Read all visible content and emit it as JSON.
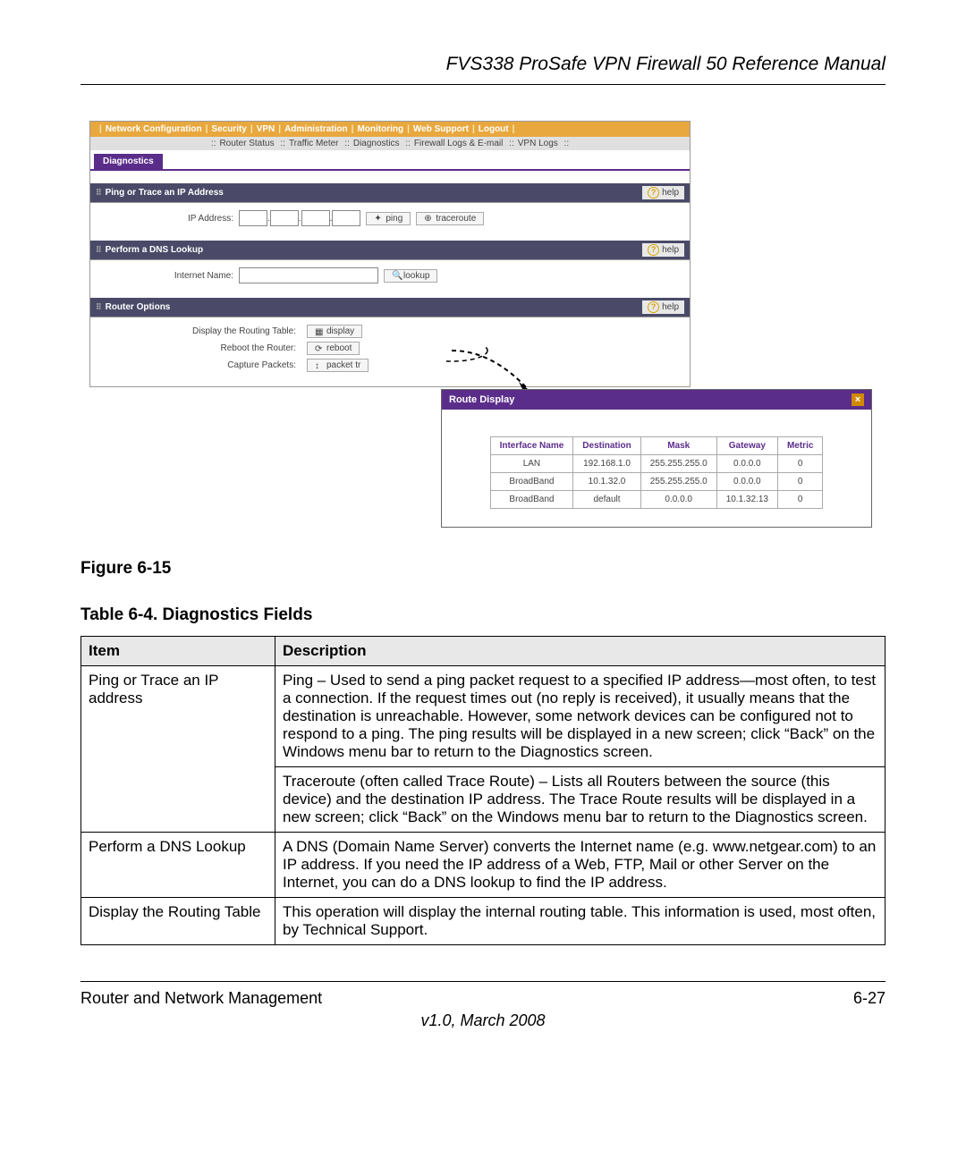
{
  "header": {
    "title": "FVS338 ProSafe VPN Firewall 50 Reference Manual"
  },
  "figure": {
    "caption": "Figure 6-15"
  },
  "ui": {
    "topnav": {
      "items": [
        "Network Configuration",
        "Security",
        "VPN",
        "Administration",
        "Monitoring",
        "Web Support",
        "Logout"
      ]
    },
    "subnav": {
      "items": [
        "Router Status",
        "Traffic Meter",
        "Diagnostics",
        "Firewall Logs & E-mail",
        "VPN Logs"
      ]
    },
    "active_tab": "Diagnostics",
    "sections": {
      "ping": {
        "title": "Ping or Trace an IP Address",
        "help": "help",
        "ip_label": "IP Address:",
        "ping_btn": "ping",
        "traceroute_btn": "traceroute"
      },
      "dns": {
        "title": "Perform a DNS Lookup",
        "help": "help",
        "name_label": "Internet Name:",
        "lookup_btn": "lookup"
      },
      "options": {
        "title": "Router Options",
        "help": "help",
        "display_label": "Display the Routing Table:",
        "display_btn": "display",
        "reboot_label": "Reboot the Router:",
        "reboot_btn": "reboot",
        "capture_label": "Capture Packets:",
        "capture_btn": "packet tr"
      }
    },
    "popup": {
      "title": "Route Display",
      "headers": [
        "Interface Name",
        "Destination",
        "Mask",
        "Gateway",
        "Metric"
      ],
      "rows": [
        [
          "LAN",
          "192.168.1.0",
          "255.255.255.0",
          "0.0.0.0",
          "0"
        ],
        [
          "BroadBand",
          "10.1.32.0",
          "255.255.255.0",
          "0.0.0.0",
          "0"
        ],
        [
          "BroadBand",
          "default",
          "0.0.0.0",
          "10.1.32.13",
          "0"
        ]
      ]
    }
  },
  "table": {
    "caption": "Table 6-4.   Diagnostics Fields",
    "headers": {
      "item": "Item",
      "desc": "Description"
    },
    "rows": [
      {
        "item": "Ping or Trace an IP address",
        "desc": "Ping – Used to send a ping packet request to a specified IP address—most often, to test a connection. If the request times out (no reply is received), it usually means that the destination is unreachable. However, some network devices can be configured not to respond to a ping. The ping results will be displayed in a new screen; click “Back” on the Windows menu bar to return to the Diagnostics screen.",
        "desc2": "Traceroute (often called Trace Route) – Lists all Routers between the source (this device) and the destination IP address. The Trace Route results will be displayed in a new screen; click “Back” on the Windows menu bar to return to the Diagnostics screen."
      },
      {
        "item": "Perform a DNS Lookup",
        "desc": "A DNS (Domain Name Server) converts the Internet name (e.g. www.netgear.com) to an IP address. If you need the IP address of a Web, FTP, Mail or other Server on the Internet, you can do a DNS lookup to find the IP address."
      },
      {
        "item": "Display the Routing Table",
        "desc": "This operation will display the internal routing table. This information is used, most often, by Technical Support."
      }
    ]
  },
  "footer": {
    "left": "Router and Network Management",
    "right": "6-27",
    "version": "v1.0, March 2008"
  }
}
